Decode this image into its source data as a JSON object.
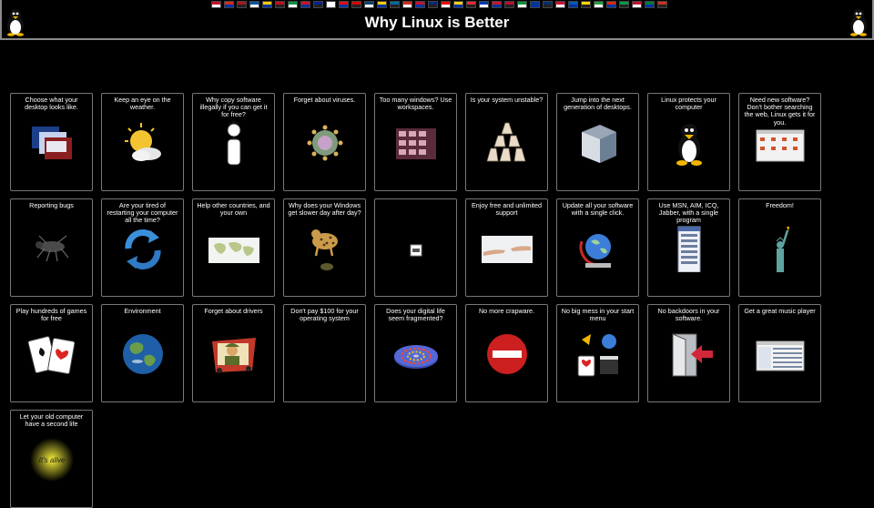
{
  "header": {
    "title": "Why Linux is Better",
    "flag_colors": [
      "#c8102e",
      "#d52b1e",
      "#aa151b",
      "#0055a4",
      "#ffce00",
      "#c60b1e",
      "#009246",
      "#ce1126",
      "#002395",
      "#fff",
      "#e30a17",
      "#dd0000",
      "#0c4076",
      "#ffcc00",
      "#006aa7",
      "#d52b1e",
      "#c8102e",
      "#00247d",
      "#e00",
      "#fcd116",
      "#ed2939",
      "#0038b8",
      "#cf142b",
      "#ba0c2f",
      "#009739",
      "#003893",
      "#002f6c",
      "#d21034",
      "#0057b7",
      "#ffd700",
      "#239f40",
      "#da291c",
      "#009a44",
      "#c8102e",
      "#007a3d",
      "#d52b1e"
    ],
    "left_mascot": "tux-penguin-icon",
    "right_mascot": "tux-penguin-icon"
  },
  "tiles": [
    {
      "caption": "Choose what your desktop looks like.",
      "icon": "desktops-icon"
    },
    {
      "caption": "Keep an eye on the weather.",
      "icon": "weather-icon"
    },
    {
      "caption": "Why copy software illegally if you can get it for free?",
      "icon": "cartoon-man-icon"
    },
    {
      "caption": "Forget about viruses.",
      "icon": "virus-icon"
    },
    {
      "caption": "Too many windows? Use workspaces.",
      "icon": "workspaces-icon"
    },
    {
      "caption": "Is your system unstable?",
      "icon": "house-of-cards-icon"
    },
    {
      "caption": "Jump into the next generation of desktops.",
      "icon": "desktop-cube-icon"
    },
    {
      "caption": "Linux protects your computer",
      "icon": "tux-icon"
    },
    {
      "caption": "Need new software? Don't bother searching the web, Linux gets it for you.",
      "icon": "software-center-icon"
    },
    {
      "caption": "Reporting bugs",
      "icon": "bug-icon"
    },
    {
      "caption": "Are your tired of restarting your computer all the time?",
      "icon": "refresh-icon"
    },
    {
      "caption": "Help other countries, and your own",
      "icon": "world-map-icon"
    },
    {
      "caption": "Why does your Windows get slower day after day?",
      "icon": "cheetah-turtle-icon"
    },
    {
      "caption": "",
      "icon": "broken-image-icon"
    },
    {
      "caption": "Enjoy free and unlimited support",
      "icon": "hands-icon"
    },
    {
      "caption": "Update all your software with a single click.",
      "icon": "globe-update-icon"
    },
    {
      "caption": "Use MSN, AIM, ICQ, Jabber, with a single program",
      "icon": "messenger-icon"
    },
    {
      "caption": "Freedom!",
      "icon": "statue-of-liberty-icon"
    },
    {
      "caption": "Play hundreds of games for free",
      "icon": "cards-icon"
    },
    {
      "caption": "Environment",
      "icon": "earth-icon"
    },
    {
      "caption": "Forget about drivers",
      "icon": "driver-man-icon"
    },
    {
      "caption": "Don't pay $100 for your operating system",
      "icon": "blank-icon"
    },
    {
      "caption": "Does your digital life seem fragmented?",
      "icon": "disk-fragment-icon"
    },
    {
      "caption": "No more crapware.",
      "icon": "no-entry-icon"
    },
    {
      "caption": "No big mess in your start menu",
      "icon": "menu-apps-icon"
    },
    {
      "caption": "No backdoors in your software.",
      "icon": "exit-door-icon"
    },
    {
      "caption": "Get a great music player",
      "icon": "music-player-icon"
    },
    {
      "caption": "Let your old computer have a second life",
      "icon": "its-alive-icon",
      "icon_text": "It's alive"
    }
  ]
}
